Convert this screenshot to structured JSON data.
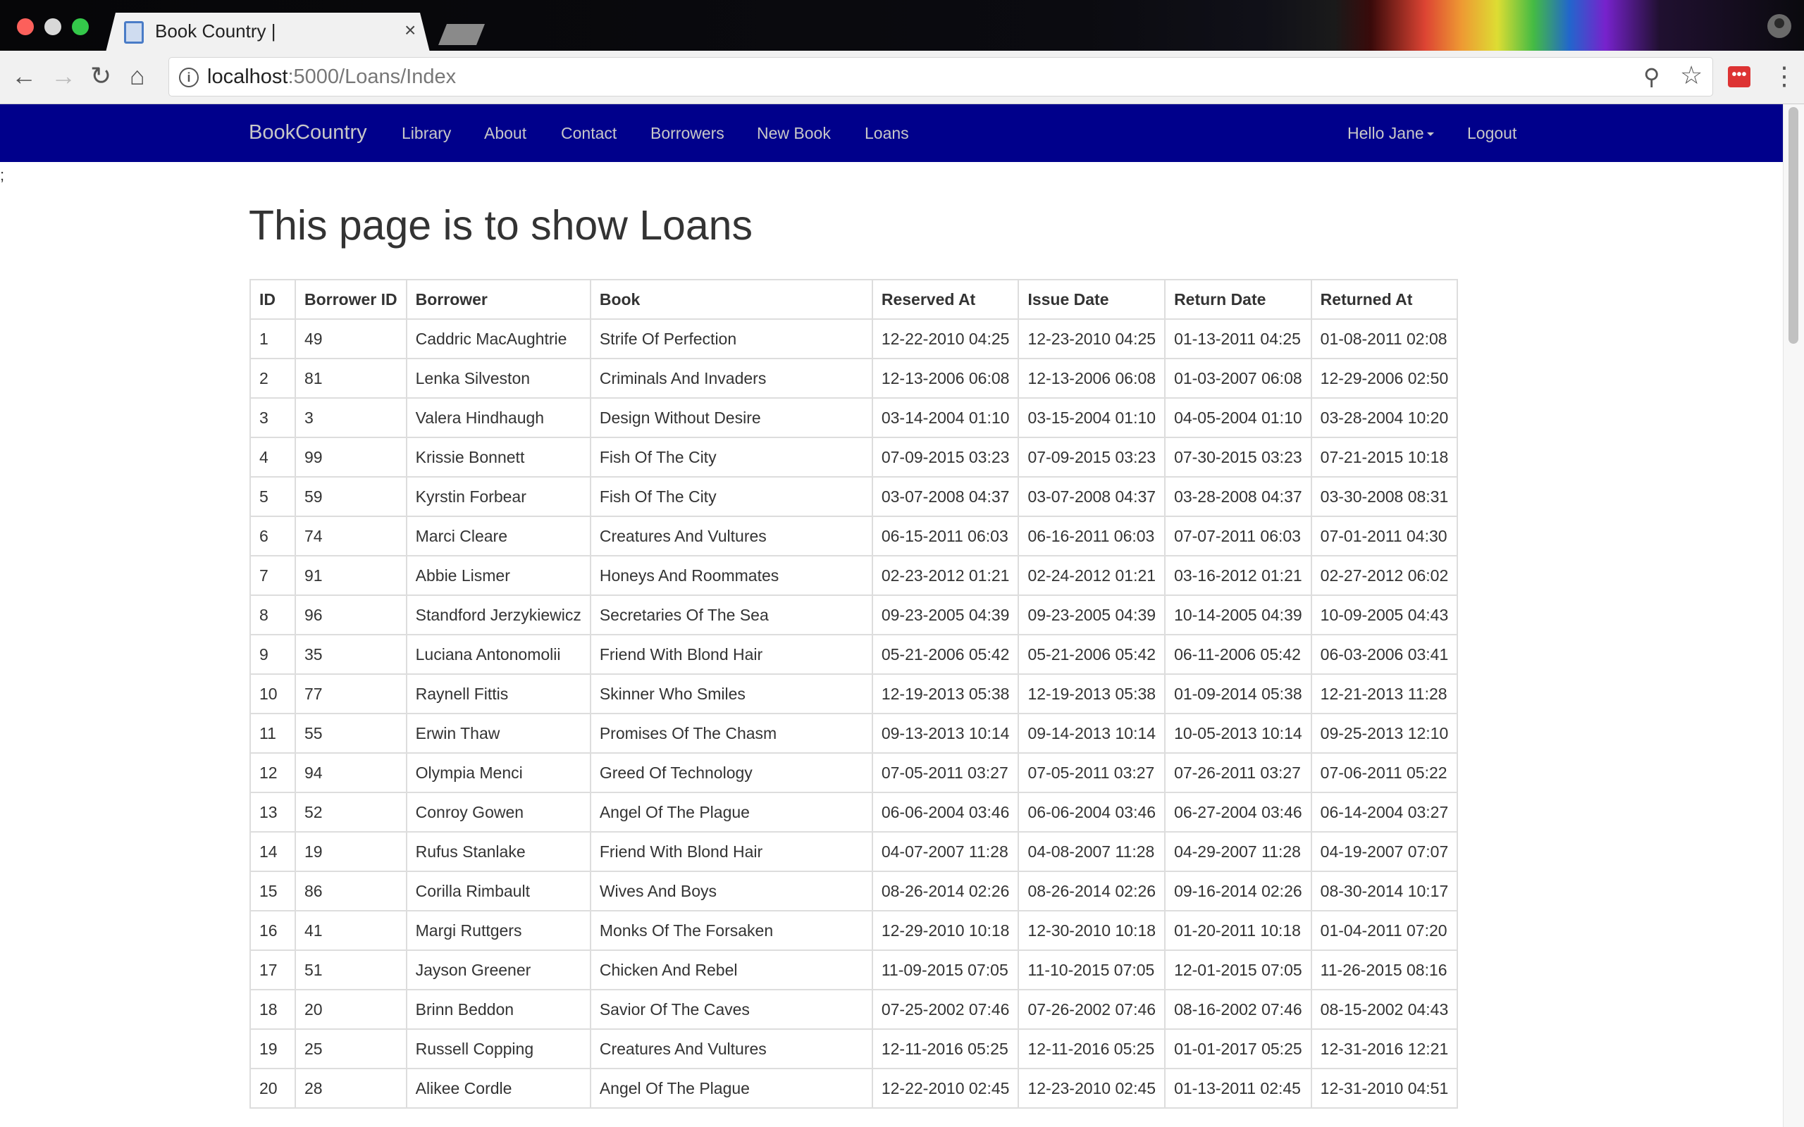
{
  "browser": {
    "tab_title": "Book Country |",
    "tab_close": "×",
    "url_host": "localhost",
    "url_rest": ":5000/Loans/Index",
    "ext_label": "•••"
  },
  "nav": {
    "brand": "BookCountry",
    "links": [
      "Library",
      "About",
      "Contact",
      "Borrowers",
      "New Book",
      "Loans"
    ],
    "user_menu": "Hello Jane",
    "logout": "Logout",
    "background": "#00008b"
  },
  "stray_text": ";",
  "page_title": "This page is to show Loans",
  "table": {
    "headers": [
      "ID",
      "Borrower ID",
      "Borrower",
      "Book",
      "Reserved At",
      "Issue Date",
      "Return Date",
      "Returned At"
    ],
    "rows": [
      [
        "1",
        "49",
        "Caddric MacAughtrie",
        "Strife Of Perfection",
        "12-22-2010 04:25",
        "12-23-2010 04:25",
        "01-13-2011 04:25",
        "01-08-2011 02:08"
      ],
      [
        "2",
        "81",
        "Lenka Silveston",
        "Criminals And Invaders",
        "12-13-2006 06:08",
        "12-13-2006 06:08",
        "01-03-2007 06:08",
        "12-29-2006 02:50"
      ],
      [
        "3",
        "3",
        "Valera Hindhaugh",
        "Design Without Desire",
        "03-14-2004 01:10",
        "03-15-2004 01:10",
        "04-05-2004 01:10",
        "03-28-2004 10:20"
      ],
      [
        "4",
        "99",
        "Krissie Bonnett",
        "Fish Of The City",
        "07-09-2015 03:23",
        "07-09-2015 03:23",
        "07-30-2015 03:23",
        "07-21-2015 10:18"
      ],
      [
        "5",
        "59",
        "Kyrstin Forbear",
        "Fish Of The City",
        "03-07-2008 04:37",
        "03-07-2008 04:37",
        "03-28-2008 04:37",
        "03-30-2008 08:31"
      ],
      [
        "6",
        "74",
        "Marci Cleare",
        "Creatures And Vultures",
        "06-15-2011 06:03",
        "06-16-2011 06:03",
        "07-07-2011 06:03",
        "07-01-2011 04:30"
      ],
      [
        "7",
        "91",
        "Abbie Lismer",
        "Honeys And Roommates",
        "02-23-2012 01:21",
        "02-24-2012 01:21",
        "03-16-2012 01:21",
        "02-27-2012 06:02"
      ],
      [
        "8",
        "96",
        "Standford Jerzykiewicz",
        "Secretaries Of The Sea",
        "09-23-2005 04:39",
        "09-23-2005 04:39",
        "10-14-2005 04:39",
        "10-09-2005 04:43"
      ],
      [
        "9",
        "35",
        "Luciana Antonomolii",
        "Friend With Blond Hair",
        "05-21-2006 05:42",
        "05-21-2006 05:42",
        "06-11-2006 05:42",
        "06-03-2006 03:41"
      ],
      [
        "10",
        "77",
        "Raynell Fittis",
        "Skinner Who Smiles",
        "12-19-2013 05:38",
        "12-19-2013 05:38",
        "01-09-2014 05:38",
        "12-21-2013 11:28"
      ],
      [
        "11",
        "55",
        "Erwin Thaw",
        "Promises Of The Chasm",
        "09-13-2013 10:14",
        "09-14-2013 10:14",
        "10-05-2013 10:14",
        "09-25-2013 12:10"
      ],
      [
        "12",
        "94",
        "Olympia Menci",
        "Greed Of Technology",
        "07-05-2011 03:27",
        "07-05-2011 03:27",
        "07-26-2011 03:27",
        "07-06-2011 05:22"
      ],
      [
        "13",
        "52",
        "Conroy Gowen",
        "Angel Of The Plague",
        "06-06-2004 03:46",
        "06-06-2004 03:46",
        "06-27-2004 03:46",
        "06-14-2004 03:27"
      ],
      [
        "14",
        "19",
        "Rufus Stanlake",
        "Friend With Blond Hair",
        "04-07-2007 11:28",
        "04-08-2007 11:28",
        "04-29-2007 11:28",
        "04-19-2007 07:07"
      ],
      [
        "15",
        "86",
        "Corilla Rimbault",
        "Wives And Boys",
        "08-26-2014 02:26",
        "08-26-2014 02:26",
        "09-16-2014 02:26",
        "08-30-2014 10:17"
      ],
      [
        "16",
        "41",
        "Margi Ruttgers",
        "Monks Of The Forsaken",
        "12-29-2010 10:18",
        "12-30-2010 10:18",
        "01-20-2011 10:18",
        "01-04-2011 07:20"
      ],
      [
        "17",
        "51",
        "Jayson Greener",
        "Chicken And Rebel",
        "11-09-2015 07:05",
        "11-10-2015 07:05",
        "12-01-2015 07:05",
        "11-26-2015 08:16"
      ],
      [
        "18",
        "20",
        "Brinn Beddon",
        "Savior Of The Caves",
        "07-25-2002 07:46",
        "07-26-2002 07:46",
        "08-16-2002 07:46",
        "08-15-2002 04:43"
      ],
      [
        "19",
        "25",
        "Russell Copping",
        "Creatures And Vultures",
        "12-11-2016 05:25",
        "12-11-2016 05:25",
        "01-01-2017 05:25",
        "12-31-2016 12:21"
      ],
      [
        "20",
        "28",
        "Alikee Cordle",
        "Angel Of The Plague",
        "12-22-2010 02:45",
        "12-23-2010 02:45",
        "01-13-2011 02:45",
        "12-31-2010 04:51"
      ]
    ]
  }
}
